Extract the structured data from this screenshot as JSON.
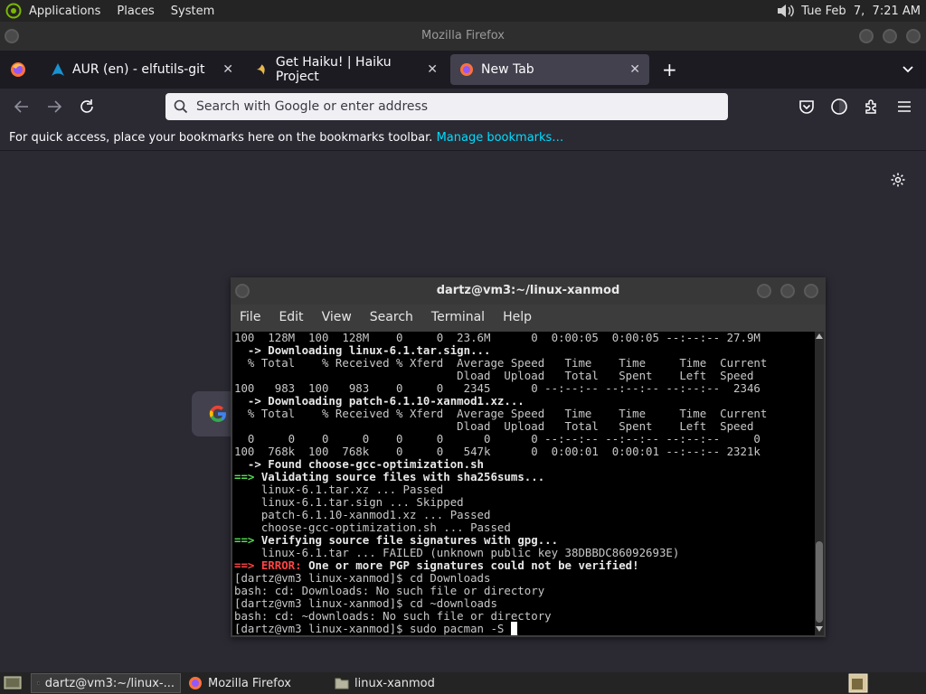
{
  "top_panel": {
    "menus": [
      "Applications",
      "Places",
      "System"
    ],
    "clock": "Tue Feb  7,  7:21 AM"
  },
  "firefox": {
    "window_title": "Mozilla Firefox",
    "tabs": [
      {
        "label": "AUR (en) - elfutils-git",
        "icon": "arch-logo-icon",
        "active": false
      },
      {
        "label": "Get Haiku! | Haiku Project",
        "icon": "haiku-leaf-icon",
        "active": false
      },
      {
        "label": "New Tab",
        "icon": "firefox-icon",
        "active": true
      }
    ],
    "search_placeholder": "Search with Google or enter address",
    "bookmarks_text": "For quick access, place your bookmarks here on the bookmarks toolbar.",
    "bookmarks_link": "Manage bookmarks…",
    "shortcut_icon": "google-icon"
  },
  "terminal": {
    "title": "dartz@vm3:~/linux-xanmod",
    "menu": [
      "File",
      "Edit",
      "View",
      "Search",
      "Terminal",
      "Help"
    ],
    "lines": [
      {
        "t": "100  128M  100  128M    0     0  23.6M      0  0:00:05  0:00:05 --:--:-- 27.9M",
        "c": ""
      },
      {
        "t": "  -> Downloading linux-6.1.tar.sign...",
        "c": "b"
      },
      {
        "t": "  % Total    % Received % Xferd  Average Speed   Time    Time     Time  Current",
        "c": ""
      },
      {
        "t": "                                 Dload  Upload   Total   Spent    Left  Speed",
        "c": ""
      },
      {
        "t": "100   983  100   983    0     0   2345      0 --:--:-- --:--:-- --:--:--  2346",
        "c": ""
      },
      {
        "t": "  -> Downloading patch-6.1.10-xanmod1.xz...",
        "c": "b"
      },
      {
        "t": "  % Total    % Received % Xferd  Average Speed   Time    Time     Time  Current",
        "c": ""
      },
      {
        "t": "                                 Dload  Upload   Total   Spent    Left  Speed",
        "c": ""
      },
      {
        "t": "  0     0    0     0    0     0      0      0 --:--:-- --:--:-- --:--:--     0",
        "c": ""
      },
      {
        "t": "100  768k  100  768k    0     0   547k      0  0:00:01  0:00:01 --:--:-- 2321k",
        "c": ""
      },
      {
        "t": "  -> Found choose-gcc-optimization.sh",
        "c": "b"
      },
      {
        "t": "==> Validating source files with sha256sums...",
        "c": "gb"
      },
      {
        "t": "    linux-6.1.tar.xz ... Passed",
        "c": ""
      },
      {
        "t": "    linux-6.1.tar.sign ... Skipped",
        "c": ""
      },
      {
        "t": "    patch-6.1.10-xanmod1.xz ... Passed",
        "c": ""
      },
      {
        "t": "    choose-gcc-optimization.sh ... Passed",
        "c": ""
      },
      {
        "t": "==> Verifying source file signatures with gpg...",
        "c": "gb"
      },
      {
        "t": "    linux-6.1.tar ... FAILED (unknown public key 38DBBDC86092693E)",
        "c": ""
      },
      {
        "t": "==> ERROR: One or more PGP signatures could not be verified!",
        "c": "err"
      },
      {
        "t": "[dartz@vm3 linux-xanmod]$ cd Downloads",
        "c": ""
      },
      {
        "t": "bash: cd: Downloads: No such file or directory",
        "c": ""
      },
      {
        "t": "[dartz@vm3 linux-xanmod]$ cd ~downloads",
        "c": ""
      },
      {
        "t": "bash: cd: ~downloads: No such file or directory",
        "c": ""
      },
      {
        "t": "[dartz@vm3 linux-xanmod]$ sudo pacman -S ",
        "c": "prompt"
      }
    ]
  },
  "taskbar": {
    "items": [
      {
        "label": "dartz@vm3:~/linux-...",
        "icon": "terminal-icon",
        "active": true
      },
      {
        "label": "Mozilla Firefox",
        "icon": "firefox-icon",
        "active": false
      },
      {
        "label": "linux-xanmod",
        "icon": "folder-icon",
        "active": false
      }
    ]
  }
}
